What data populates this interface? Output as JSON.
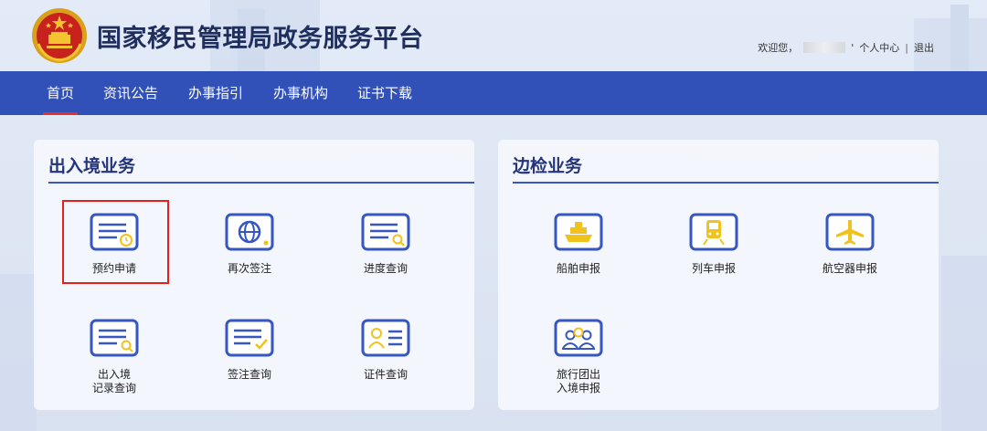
{
  "header": {
    "site_title": "国家移民管理局政务服务平台",
    "welcome": "欢迎您，",
    "quote_mark": "'",
    "user_center": "个人中心",
    "separator": "|",
    "logout": "退出"
  },
  "nav": {
    "items": [
      {
        "label": "首页",
        "active": true
      },
      {
        "label": "资讯公告"
      },
      {
        "label": "办事指引"
      },
      {
        "label": "办事机构"
      },
      {
        "label": "证书下载"
      }
    ]
  },
  "panels": {
    "entry_exit": {
      "title": "出入境业务",
      "services": [
        {
          "label": "预约申请",
          "icon": "appointment-icon"
        },
        {
          "label": "再次签注",
          "icon": "globe-icon"
        },
        {
          "label": "进度查询",
          "icon": "progress-search-icon"
        },
        {
          "label_line1": "出入境",
          "label_line2": "记录查询",
          "icon": "record-search-icon"
        },
        {
          "label": "签注查询",
          "icon": "endorsement-check-icon"
        },
        {
          "label": "证件查询",
          "icon": "id-card-icon"
        }
      ]
    },
    "border": {
      "title": "边检业务",
      "services": [
        {
          "label": "船舶申报",
          "icon": "ship-icon"
        },
        {
          "label": "列车申报",
          "icon": "train-icon"
        },
        {
          "label": "航空器申报",
          "icon": "airplane-icon"
        },
        {
          "label_line1": "旅行团出",
          "label_line2": "入境申报",
          "icon": "tour-group-icon"
        }
      ]
    }
  },
  "colors": {
    "nav_bg": "#3151b9",
    "accent_red": "#e3201b",
    "icon_blue": "#3656c2",
    "icon_yellow": "#f1c21b"
  }
}
